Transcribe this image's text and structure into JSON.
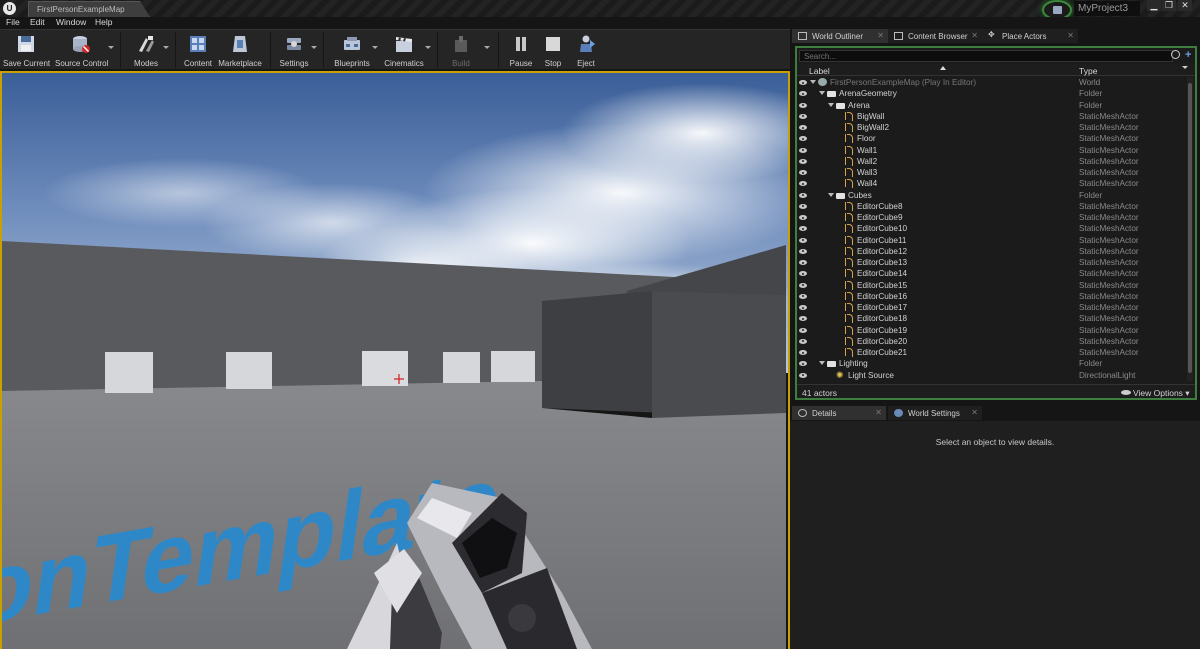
{
  "titlebar": {
    "logo": "U",
    "level_tab": "FirstPersonExampleMap",
    "project_name": "MyProject3",
    "minimize": "▁",
    "maximize": "❐",
    "close": "✕"
  },
  "menu": [
    "File",
    "Edit",
    "Window",
    "Help"
  ],
  "toolbar": {
    "save_current": "Save Current",
    "source_control": "Source Control",
    "modes": "Modes",
    "content": "Content",
    "marketplace": "Marketplace",
    "settings": "Settings",
    "blueprints": "Blueprints",
    "cinematics": "Cinematics",
    "build": "Build",
    "pause": "Pause",
    "stop": "Stop",
    "eject": "Eject"
  },
  "floor_text": "ersonTemplate",
  "tabs_top": {
    "world_outliner": "World Outliner",
    "content_browser": "Content Browser",
    "place_actors": "Place Actors"
  },
  "outliner": {
    "search_placeholder": "Search...",
    "col_label": "Label",
    "col_type": "Type",
    "rows": [
      {
        "name": "FirstPersonExampleMap (Play In Editor)",
        "type": "World",
        "indent": 0,
        "icon": "world",
        "arrow": true,
        "dim": true
      },
      {
        "name": "ArenaGeometry",
        "type": "Folder",
        "indent": 1,
        "icon": "folder",
        "arrow": true
      },
      {
        "name": "Arena",
        "type": "Folder",
        "indent": 2,
        "icon": "folder",
        "arrow": true
      },
      {
        "name": "BigWall",
        "type": "StaticMeshActor",
        "indent": 3,
        "icon": "mesh"
      },
      {
        "name": "BigWall2",
        "type": "StaticMeshActor",
        "indent": 3,
        "icon": "mesh"
      },
      {
        "name": "Floor",
        "type": "StaticMeshActor",
        "indent": 3,
        "icon": "mesh"
      },
      {
        "name": "Wall1",
        "type": "StaticMeshActor",
        "indent": 3,
        "icon": "mesh"
      },
      {
        "name": "Wall2",
        "type": "StaticMeshActor",
        "indent": 3,
        "icon": "mesh"
      },
      {
        "name": "Wall3",
        "type": "StaticMeshActor",
        "indent": 3,
        "icon": "mesh"
      },
      {
        "name": "Wall4",
        "type": "StaticMeshActor",
        "indent": 3,
        "icon": "mesh"
      },
      {
        "name": "Cubes",
        "type": "Folder",
        "indent": 2,
        "icon": "folder",
        "arrow": true
      },
      {
        "name": "EditorCube8",
        "type": "StaticMeshActor",
        "indent": 3,
        "icon": "mesh"
      },
      {
        "name": "EditorCube9",
        "type": "StaticMeshActor",
        "indent": 3,
        "icon": "mesh"
      },
      {
        "name": "EditorCube10",
        "type": "StaticMeshActor",
        "indent": 3,
        "icon": "mesh"
      },
      {
        "name": "EditorCube11",
        "type": "StaticMeshActor",
        "indent": 3,
        "icon": "mesh"
      },
      {
        "name": "EditorCube12",
        "type": "StaticMeshActor",
        "indent": 3,
        "icon": "mesh"
      },
      {
        "name": "EditorCube13",
        "type": "StaticMeshActor",
        "indent": 3,
        "icon": "mesh"
      },
      {
        "name": "EditorCube14",
        "type": "StaticMeshActor",
        "indent": 3,
        "icon": "mesh"
      },
      {
        "name": "EditorCube15",
        "type": "StaticMeshActor",
        "indent": 3,
        "icon": "mesh"
      },
      {
        "name": "EditorCube16",
        "type": "StaticMeshActor",
        "indent": 3,
        "icon": "mesh"
      },
      {
        "name": "EditorCube17",
        "type": "StaticMeshActor",
        "indent": 3,
        "icon": "mesh"
      },
      {
        "name": "EditorCube18",
        "type": "StaticMeshActor",
        "indent": 3,
        "icon": "mesh"
      },
      {
        "name": "EditorCube19",
        "type": "StaticMeshActor",
        "indent": 3,
        "icon": "mesh"
      },
      {
        "name": "EditorCube20",
        "type": "StaticMeshActor",
        "indent": 3,
        "icon": "mesh"
      },
      {
        "name": "EditorCube21",
        "type": "StaticMeshActor",
        "indent": 3,
        "icon": "mesh"
      },
      {
        "name": "Lighting",
        "type": "Folder",
        "indent": 1,
        "icon": "folder",
        "arrow": true
      },
      {
        "name": "Light Source",
        "type": "DirectionalLight",
        "indent": 2,
        "icon": "light"
      }
    ],
    "actor_count": "41 actors",
    "view_options": "View Options"
  },
  "tabs_bottom": {
    "details": "Details",
    "world_settings": "World Settings"
  },
  "details": {
    "empty_message": "Select an object to view details."
  },
  "colors": {
    "viewport_border": "#c8a000",
    "outliner_border": "#3e7e3e",
    "floor_text": "#2e88c8"
  }
}
